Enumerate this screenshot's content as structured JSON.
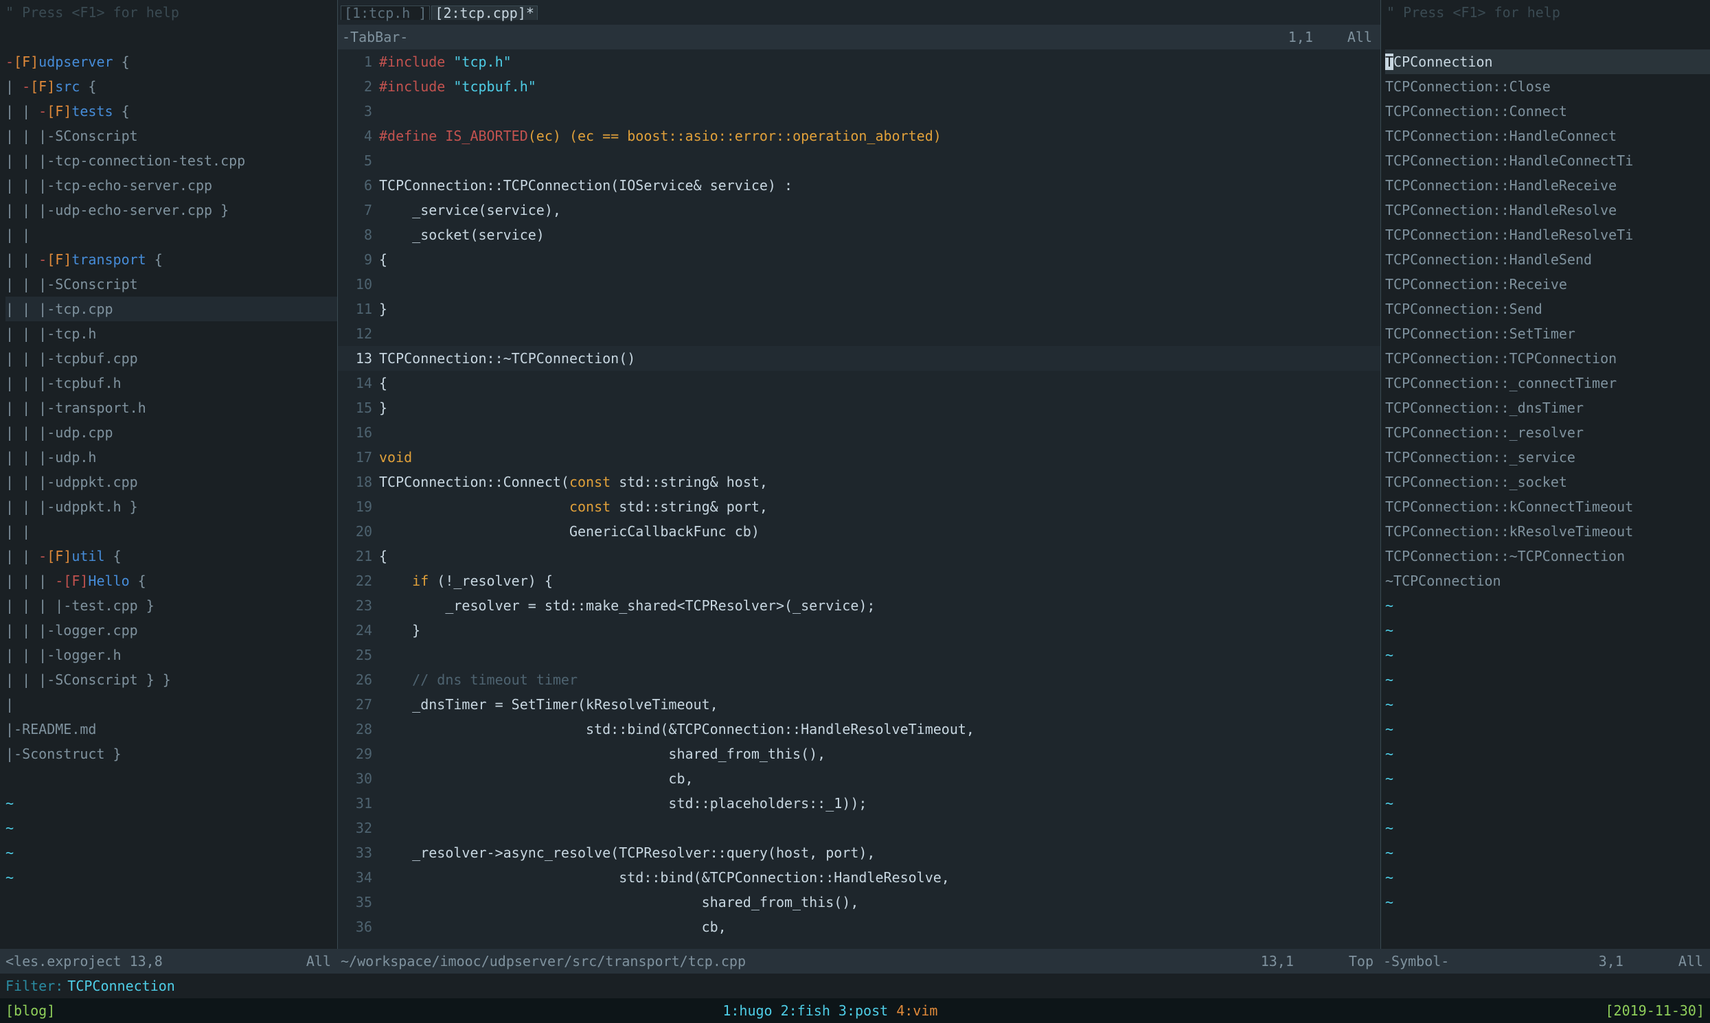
{
  "hint_text": "\" Press <F1> for help",
  "tree": [
    {
      "pre": "",
      "f": "-",
      "b": "[F]",
      "d": "udpserver",
      "suf": " {",
      "cls": ""
    },
    {
      "pre": "| ",
      "f": "-",
      "b": "[F]",
      "d": "src",
      "suf": " {",
      "cls": ""
    },
    {
      "pre": "| | ",
      "f": "-",
      "b": "[F]",
      "d": "tests",
      "suf": " {",
      "cls": ""
    },
    {
      "pre": "| | ",
      "txt": "|-SConscript"
    },
    {
      "pre": "| | ",
      "txt": "|-tcp-connection-test.cpp"
    },
    {
      "pre": "| | ",
      "txt": "|-tcp-echo-server.cpp"
    },
    {
      "pre": "| | ",
      "txt": "|-udp-echo-server.cpp }"
    },
    {
      "pre": "| |"
    },
    {
      "pre": "| | ",
      "f": "-",
      "b": "[F]",
      "d": "transport",
      "suf": " {",
      "cls": ""
    },
    {
      "pre": "| | ",
      "txt": "|-SConscript"
    },
    {
      "pre": "| | ",
      "txt": "|-tcp.cpp",
      "hl": true
    },
    {
      "pre": "| | ",
      "txt": "|-tcp.h"
    },
    {
      "pre": "| | ",
      "txt": "|-tcpbuf.cpp"
    },
    {
      "pre": "| | ",
      "txt": "|-tcpbuf.h"
    },
    {
      "pre": "| | ",
      "txt": "|-transport.h"
    },
    {
      "pre": "| | ",
      "txt": "|-udp.cpp"
    },
    {
      "pre": "| | ",
      "txt": "|-udp.h"
    },
    {
      "pre": "| | ",
      "txt": "|-udppkt.cpp"
    },
    {
      "pre": "| | ",
      "txt": "|-udppkt.h }"
    },
    {
      "pre": "| |"
    },
    {
      "pre": "| | ",
      "f": "-",
      "b": "[F]",
      "d": "util",
      "suf": " {",
      "cls": ""
    },
    {
      "pre": "| | | ",
      "f": "-",
      "b": "[F]",
      "d": "Hello",
      "suf": " {",
      "cls": "sub"
    },
    {
      "pre": "| | | ",
      "txt": "|-test.cpp }"
    },
    {
      "pre": "| | ",
      "txt": "|-logger.cpp"
    },
    {
      "pre": "| | ",
      "txt": "|-logger.h"
    },
    {
      "pre": "| | ",
      "txt": "|-SConscript } }"
    },
    {
      "pre": "|"
    },
    {
      "pre": "",
      "txt": "|-README.md"
    },
    {
      "pre": "",
      "txt": "|-Sconstruct }"
    }
  ],
  "tree_tildes": [
    "~",
    "~",
    "~",
    "~"
  ],
  "tabs": [
    {
      "label": "[1:tcp.h ]",
      "active": false
    },
    {
      "label": "[2:tcp.cpp]*",
      "active": true
    }
  ],
  "tabbar": {
    "label": "-TabBar-",
    "pos": "1,1",
    "pct": "All"
  },
  "code": [
    {
      "n": 1,
      "segs": [
        {
          "t": "#include ",
          "c": "c-pre"
        },
        {
          "t": "\"tcp.h\"",
          "c": "c-str"
        }
      ]
    },
    {
      "n": 2,
      "segs": [
        {
          "t": "#include ",
          "c": "c-pre"
        },
        {
          "t": "\"tcpbuf.h\"",
          "c": "c-str"
        }
      ]
    },
    {
      "n": 3,
      "segs": []
    },
    {
      "n": 4,
      "segs": [
        {
          "t": "#define IS_ABORTED",
          "c": "c-pre"
        },
        {
          "t": "(ec) (ec == boost::asio::error::operation_aborted)",
          "c": "c-kw"
        }
      ]
    },
    {
      "n": 5,
      "segs": []
    },
    {
      "n": 6,
      "segs": [
        {
          "t": "TCPConnection::TCPConnection(IOService& service) :",
          "c": "c-text"
        }
      ]
    },
    {
      "n": 7,
      "segs": [
        {
          "t": "    _service(service),",
          "c": "c-text"
        }
      ]
    },
    {
      "n": 8,
      "segs": [
        {
          "t": "    _socket(service)",
          "c": "c-text"
        }
      ]
    },
    {
      "n": 9,
      "segs": [
        {
          "t": "{",
          "c": "c-text"
        }
      ]
    },
    {
      "n": 10,
      "segs": []
    },
    {
      "n": 11,
      "segs": [
        {
          "t": "}",
          "c": "c-text"
        }
      ]
    },
    {
      "n": 12,
      "segs": []
    },
    {
      "n": 13,
      "hl": true,
      "segs": [
        {
          "t": "TCPConnection::~TCPConnection()",
          "c": "c-text"
        }
      ]
    },
    {
      "n": 14,
      "segs": [
        {
          "t": "{",
          "c": "c-text"
        }
      ]
    },
    {
      "n": 15,
      "segs": [
        {
          "t": "}",
          "c": "c-text"
        }
      ]
    },
    {
      "n": 16,
      "segs": []
    },
    {
      "n": 17,
      "segs": [
        {
          "t": "void",
          "c": "c-kw"
        }
      ]
    },
    {
      "n": 18,
      "segs": [
        {
          "t": "TCPConnection::Connect(",
          "c": "c-text"
        },
        {
          "t": "const",
          "c": "c-kw"
        },
        {
          "t": " std::string& host,",
          "c": "c-text"
        }
      ]
    },
    {
      "n": 19,
      "segs": [
        {
          "t": "                       ",
          "c": "c-text"
        },
        {
          "t": "const",
          "c": "c-kw"
        },
        {
          "t": " std::string& port,",
          "c": "c-text"
        }
      ]
    },
    {
      "n": 20,
      "segs": [
        {
          "t": "                       GenericCallbackFunc cb)",
          "c": "c-text"
        }
      ]
    },
    {
      "n": 21,
      "segs": [
        {
          "t": "{",
          "c": "c-text"
        }
      ]
    },
    {
      "n": 22,
      "segs": [
        {
          "t": "    ",
          "c": ""
        },
        {
          "t": "if",
          "c": "c-kw"
        },
        {
          "t": " (!_resolver) {",
          "c": "c-text"
        }
      ]
    },
    {
      "n": 23,
      "segs": [
        {
          "t": "        _resolver = std::make_shared<TCPResolver>(_service);",
          "c": "c-text"
        }
      ]
    },
    {
      "n": 24,
      "segs": [
        {
          "t": "    }",
          "c": "c-text"
        }
      ]
    },
    {
      "n": 25,
      "segs": []
    },
    {
      "n": 26,
      "segs": [
        {
          "t": "    // dns timeout timer",
          "c": "c-comment"
        }
      ]
    },
    {
      "n": 27,
      "segs": [
        {
          "t": "    _dnsTimer = SetTimer(kResolveTimeout,",
          "c": "c-text"
        }
      ]
    },
    {
      "n": 28,
      "segs": [
        {
          "t": "                         std::bind(&TCPConnection::HandleResolveTimeout,",
          "c": "c-text"
        }
      ]
    },
    {
      "n": 29,
      "segs": [
        {
          "t": "                                   shared_from_this(),",
          "c": "c-text"
        }
      ]
    },
    {
      "n": 30,
      "segs": [
        {
          "t": "                                   cb,",
          "c": "c-text"
        }
      ]
    },
    {
      "n": 31,
      "segs": [
        {
          "t": "                                   std::placeholders::_1));",
          "c": "c-text"
        }
      ]
    },
    {
      "n": 32,
      "segs": []
    },
    {
      "n": 33,
      "segs": [
        {
          "t": "    _resolver->async_resolve(TCPResolver::query(host, port),",
          "c": "c-text"
        }
      ]
    },
    {
      "n": 34,
      "segs": [
        {
          "t": "                             std::bind(&TCPConnection::HandleResolve,",
          "c": "c-text"
        }
      ]
    },
    {
      "n": 35,
      "segs": [
        {
          "t": "                                       shared_from_this(),",
          "c": "c-text"
        }
      ]
    },
    {
      "n": 36,
      "segs": [
        {
          "t": "                                       cb,",
          "c": "c-text"
        }
      ]
    }
  ],
  "symbols": [
    "TCPConnection",
    "TCPConnection::Close",
    "TCPConnection::Connect",
    "TCPConnection::HandleConnect",
    "TCPConnection::HandleConnectTi",
    "TCPConnection::HandleReceive",
    "TCPConnection::HandleResolve",
    "TCPConnection::HandleResolveTi",
    "TCPConnection::HandleSend",
    "TCPConnection::Receive",
    "TCPConnection::Send",
    "TCPConnection::SetTimer",
    "TCPConnection::TCPConnection",
    "TCPConnection::_connectTimer",
    "TCPConnection::_dnsTimer",
    "TCPConnection::_resolver",
    "TCPConnection::_service",
    "TCPConnection::_socket",
    "TCPConnection::kConnectTimeout",
    "TCPConnection::kResolveTimeout",
    "TCPConnection::~TCPConnection",
    "~TCPConnection"
  ],
  "sym_tildes": [
    "~",
    "~",
    "~",
    "~",
    "~",
    "~",
    "~",
    "~",
    "~",
    "~",
    "~",
    "~",
    "~"
  ],
  "status": {
    "left": {
      "file": "<les.exproject",
      "pos": "13,8",
      "pct": "All"
    },
    "center": {
      "file": "~/workspace/imooc/udpserver/src/transport/tcp.cpp",
      "pos": "13,1",
      "pct": "Top"
    },
    "right": {
      "label": "-Symbol-",
      "pos": "3,1",
      "pct": "All"
    }
  },
  "filter": {
    "label": "Filter:",
    "value": "TCPConnection"
  },
  "tmux": {
    "left": "[blog]",
    "windows": "1:hugo 2:fish 3:post ",
    "active": "4:vim",
    "right": "[2019-11-30]"
  }
}
